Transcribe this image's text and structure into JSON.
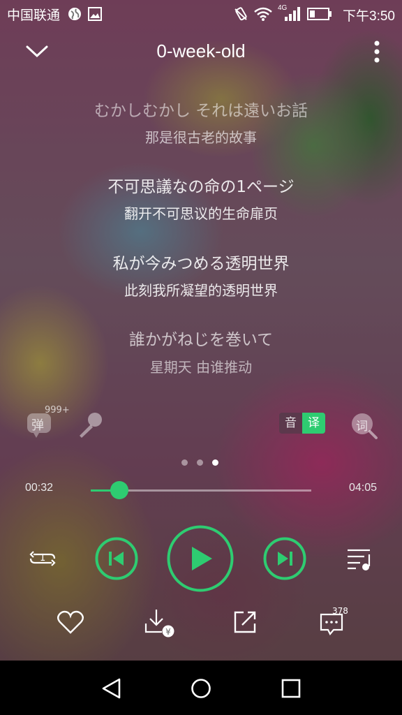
{
  "status_bar": {
    "carrier": "中国联通",
    "network": "4G",
    "time": "下午3:50"
  },
  "header": {
    "title": "0-week-old"
  },
  "lyrics": [
    {
      "jp": "むかしむかし それは遠いお話",
      "cn": "那是很古老的故事"
    },
    {
      "jp": "不可思議なの命の1ページ",
      "cn": "翻开不可思议的生命扉页"
    },
    {
      "jp": "私が今みつめる透明世界",
      "cn": "此刻我所凝望的透明世界"
    },
    {
      "jp": "誰かがねじを巻いて",
      "cn": "星期天 由谁推动"
    }
  ],
  "tools": {
    "danmaku_label": "弹",
    "danmaku_count": "999+",
    "toggle_yin": "音",
    "toggle_yi": "译",
    "lyrics_search_label": "词"
  },
  "progress": {
    "current": "00:32",
    "total": "04:05",
    "fraction": 0.13
  },
  "pager": {
    "count": 3,
    "active": 2
  },
  "repeat_badge": "1",
  "comment_count": "378",
  "colors": {
    "accent": "#2ecc71",
    "accent_dark": "#27ae60",
    "lyric_dim": "#d0d0d0"
  }
}
